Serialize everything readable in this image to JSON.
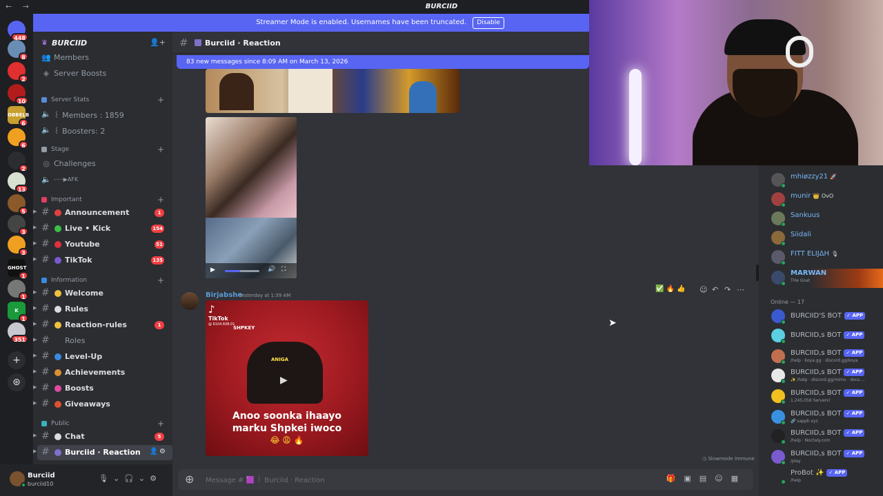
{
  "window": {
    "title": "BURCIID",
    "nav": "← →"
  },
  "banner": {
    "text": "Streamer Mode is enabled. Usernames have been truncated.",
    "button": "Disable"
  },
  "server": {
    "name": "BURCIID",
    "chevron": "⌄"
  },
  "rail": {
    "servers": [
      {
        "badge": "448",
        "color": "#5865f2"
      },
      {
        "badge": "8",
        "color": "#6a8db5"
      },
      {
        "badge": "2",
        "color": "#e03030"
      },
      {
        "badge": "10",
        "color": "#b21c1c"
      },
      {
        "badge": "6",
        "color": "#c8a030",
        "text": "OBBELB"
      },
      {
        "badge": "6",
        "color": "#f0a020"
      },
      {
        "badge": "2",
        "color": "#2b2d31"
      },
      {
        "badge": "13",
        "color": "#d8e0d0"
      },
      {
        "badge": "5",
        "color": "#8a5a2a"
      },
      {
        "badge": "3",
        "color": "#444"
      },
      {
        "badge": "3",
        "color": "#f0a020"
      },
      {
        "badge": "1",
        "color": "#111",
        "text": "GHOST"
      },
      {
        "badge": "1",
        "color": "#777"
      },
      {
        "badge": "1",
        "color": "#1a9a3a",
        "text": "K"
      },
      {
        "badge": "351",
        "color": "#c8c8d0"
      }
    ]
  },
  "sidebar": {
    "top": [
      {
        "label": "Members",
        "icon": "members-icon"
      },
      {
        "label": "Server Boosts",
        "icon": "boost-icon"
      }
    ],
    "cat_server_stats": "Server Stats",
    "stats": [
      "꒰ Members : 1859",
      "꒰ Boosters: 2"
    ],
    "cat_stage": "Stage",
    "stage": [
      "Challenges",
      "-·-·-▶AFK"
    ],
    "cat_important": "Important",
    "important": [
      {
        "label": "Announcement",
        "count": "1",
        "color": "#e04040"
      },
      {
        "label": "Live • Kick",
        "count": "154",
        "color": "#3ac04a"
      },
      {
        "label": "Youtube",
        "count": "51",
        "color": "#e03040"
      },
      {
        "label": "TikTok",
        "count": "135",
        "color": "#7a5ad0"
      }
    ],
    "cat_information": "Information",
    "information": [
      {
        "label": "Welcome",
        "count": "",
        "color": "#f0c040"
      },
      {
        "label": "Rules",
        "count": "",
        "color": "#dcdcdc"
      },
      {
        "label": "Reaction-rules",
        "count": "1",
        "color": "#f0c040"
      },
      {
        "label": "Roles",
        "count": "",
        "color": ""
      },
      {
        "label": "Level-Up",
        "count": "",
        "color": "#3a8ae0"
      },
      {
        "label": "Achievements",
        "count": "",
        "color": "#d89030"
      },
      {
        "label": "Boosts",
        "count": "",
        "color": "#e04aa0"
      },
      {
        "label": "Giveaways",
        "count": "",
        "color": "#e05030"
      }
    ],
    "cat_public": "Public",
    "public": [
      {
        "label": "Chat",
        "count": "5",
        "color": "#dcdcdc"
      },
      {
        "label": "Burciid · Reaction",
        "count": "",
        "color": "#7f70c8"
      }
    ]
  },
  "user": {
    "name": "Burciid",
    "tag": "burciid10"
  },
  "channel": {
    "name": "Burciid · Reaction"
  },
  "newbar": "83 new messages since 8:09 AM on March 13, 2026",
  "message": {
    "author": "Birjabshe",
    "time": "Yesterday at 1:39 AM",
    "hover_icons": "✅ 🔥 👍"
  },
  "tiktok": {
    "brand": "TikTok",
    "id": "@ 6104.608.01",
    "watermark": "SHPKEY",
    "label": "ANIGA",
    "caption1": "Anoo soonka ihaayo",
    "caption2": "marku Shpkei iwoco",
    "emojis": "😂 😩 🔥"
  },
  "slowmode": "Slowmode Immune",
  "composer": {
    "placeholder": "Message # 🟪 ꒰ Burciid · Reaction"
  },
  "members_list": {
    "online_header": "Online — 17",
    "top": [
      {
        "name": "mhiøzzy21",
        "suffix": "🚀",
        "color": "#7ab8f5",
        "avatar": "#555"
      },
      {
        "name": "munir",
        "suffix": "👑 OvO",
        "color": "#7ab8f5",
        "avatar": "#a04040"
      },
      {
        "name": "Sankuus",
        "suffix": "",
        "color": "#7ab8f5",
        "avatar": "#6a7a5a"
      },
      {
        "name": "Siidali",
        "suffix": "",
        "color": "#7ab8f5",
        "avatar": "#8a6a3a"
      },
      {
        "name": "FITT ELIJΔH",
        "suffix": "🎙",
        "color": "#7ab8f5",
        "avatar": "#5a5a6a"
      },
      {
        "name": "MARWAN",
        "sub": "THe Goat",
        "color": "#7ab8f5",
        "avatar": "#3a4a6a",
        "hl": true
      }
    ],
    "bots": [
      {
        "name": "BURCIID'S BOT",
        "sub": "",
        "avatar": "#3a5ad0"
      },
      {
        "name": "BURCIID,s BOT",
        "sub": "",
        "avatar": "#5ad0e0"
      },
      {
        "name": "BURCIID,s BOT",
        "sub": "/help · koya.gg · discord.gg/koya",
        "avatar": "#c07050"
      },
      {
        "name": "BURCIID,s BOT",
        "sub": "✨ /help · discord.gg/mimu · docs....",
        "avatar": "#e8e8e8"
      },
      {
        "name": "BURCIID,s BOT",
        "sub": "1,245,058 Servers!",
        "avatar": "#f0c020"
      },
      {
        "name": "BURCIID,s BOT",
        "sub": "🔗 sapph.xyz",
        "avatar": "#3a90e0"
      },
      {
        "name": "BURCIID,s BOT",
        "sub": "/help · Noctaly.com",
        "avatar": "#222"
      },
      {
        "name": "BURCIID,s BOT",
        "sub": "/play",
        "avatar": "#7a5ad0"
      },
      {
        "name": "ProBot ✨",
        "sub": "/help",
        "avatar": "#2b2d31"
      }
    ],
    "app_badge": "✓ APP"
  }
}
